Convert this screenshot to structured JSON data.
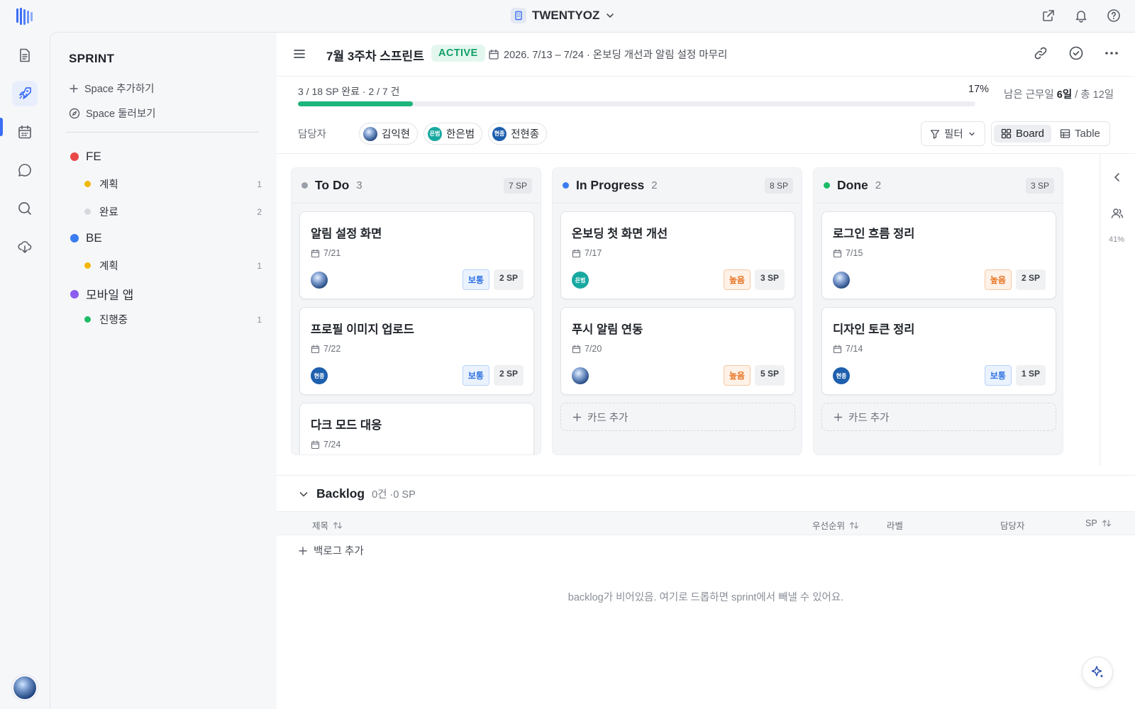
{
  "workspace": {
    "name": "TWENTYOZ"
  },
  "sidebar": {
    "title": "SPRINT",
    "add_space": "Space 추가하기",
    "browse_space": "Space 둘러보기",
    "groups": [
      {
        "name": "FE",
        "color": "#e94848",
        "items": [
          {
            "label": "계획",
            "count": "1",
            "color": "#f2b705"
          },
          {
            "label": "완료",
            "count": "2",
            "color": "#d5d8dc"
          }
        ]
      },
      {
        "name": "BE",
        "color": "#3b7df0",
        "items": [
          {
            "label": "계획",
            "count": "1",
            "color": "#f2b705"
          }
        ]
      },
      {
        "name": "모바일 앱",
        "color": "#8c5cf0",
        "items": [
          {
            "label": "진행중",
            "count": "1",
            "color": "#1dbb66"
          }
        ]
      }
    ]
  },
  "sprint": {
    "title": "7월 3주차 스프린트",
    "status": "ACTIVE",
    "dates": "2026. 7/13 – 7/24 · 온보딩 개선과 알림 설정 마무리",
    "progress_text": "3 / 18 SP 완료 · 2 / 7 건",
    "progress_percent": "17%",
    "progress_fraction": 0.17,
    "remain_label": "남은 근무일",
    "remain_days": "6일",
    "remain_total": "/ 총 12일"
  },
  "assignees": {
    "label": "담당자",
    "people": [
      {
        "name": "김익현",
        "avatar": "photo",
        "initials": ""
      },
      {
        "name": "한은범",
        "avatar": "t",
        "initials": "은범"
      },
      {
        "name": "전현종",
        "avatar": "d",
        "initials": "현종"
      }
    ]
  },
  "toolbar": {
    "filter": "필터",
    "board": "Board",
    "table": "Table"
  },
  "columns": [
    {
      "name": "To Do",
      "count": "3",
      "sp": "7 SP",
      "color": "#9aa0a8",
      "cards": [
        {
          "title": "알림 설정 화면",
          "date": "7/21",
          "avatar": "photo",
          "initials": "",
          "priority": "보통",
          "ptype": "normal",
          "sp": "2 SP"
        },
        {
          "title": "프로필 이미지 업로드",
          "date": "7/22",
          "avatar": "d",
          "initials": "현종",
          "priority": "보통",
          "ptype": "normal",
          "sp": "2 SP"
        },
        {
          "title": "다크 모드 대응",
          "date": "7/24",
          "avatar": "",
          "initials": "",
          "priority": "",
          "ptype": "",
          "sp": ""
        }
      ]
    },
    {
      "name": "In Progress",
      "count": "2",
      "sp": "8 SP",
      "color": "#3b7df0",
      "cards": [
        {
          "title": "온보딩 첫 화면 개선",
          "date": "7/17",
          "avatar": "t",
          "initials": "은범",
          "priority": "높음",
          "ptype": "high",
          "sp": "3 SP"
        },
        {
          "title": "푸시 알림 연동",
          "date": "7/20",
          "avatar": "photo",
          "initials": "",
          "priority": "높음",
          "ptype": "high",
          "sp": "5 SP"
        }
      ],
      "add_label": "카드 추가"
    },
    {
      "name": "Done",
      "count": "2",
      "sp": "3 SP",
      "color": "#1dbb66",
      "cards": [
        {
          "title": "로그인 흐름 정리",
          "date": "7/15",
          "avatar": "photo",
          "initials": "",
          "priority": "높음",
          "ptype": "high",
          "sp": "2 SP"
        },
        {
          "title": "디자인 토큰 정리",
          "date": "7/14",
          "avatar": "d",
          "initials": "현종",
          "priority": "보통",
          "ptype": "normal",
          "sp": "1 SP"
        }
      ],
      "add_label": "카드 추가"
    }
  ],
  "right_panel": {
    "percent": "41%"
  },
  "backlog": {
    "title": "Backlog",
    "summary": "0건 ·0 SP",
    "columns": {
      "title": "제목",
      "priority": "우선순위",
      "label": "라벨",
      "assignee": "담당자",
      "sp": "SP"
    },
    "add_label": "백로그 추가",
    "empty_message": "backlog가 비어있음. 여기로 드롭하면 sprint에서 빼낼 수 있어요."
  }
}
